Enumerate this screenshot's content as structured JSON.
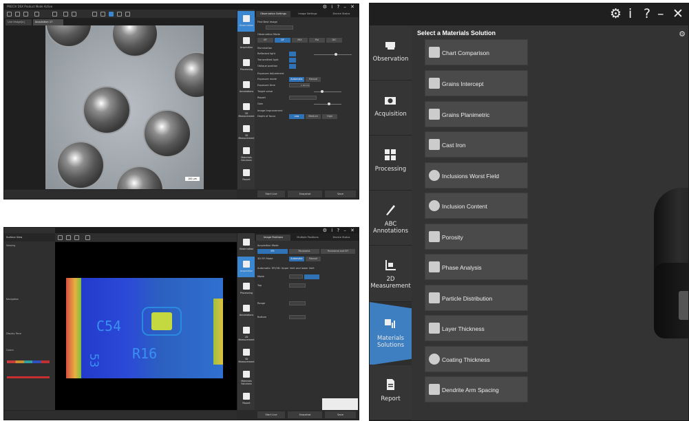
{
  "screen1": {
    "window_title": "PRECiV DSX Product Mode Active",
    "view_tabs": [
      "Live Image[x]",
      "Acquisition 17"
    ],
    "rail_items": [
      "Observation",
      "Acquisition",
      "Processing",
      "Annotations",
      "2D Measurement",
      "3D Measurement",
      "Materials Solutions",
      "Report"
    ],
    "panel_tabs": [
      "Observation Settings",
      "Image Settings",
      "Device Status"
    ],
    "find_best_image": "Find Best Image",
    "observation_mode": "Observation Mode",
    "mode_buttons": [
      "BF",
      "DF",
      "MIX",
      "Pol",
      "DIC"
    ],
    "illumination": "Illumination",
    "reflected_light": "Reflected light",
    "transmitted_light": "Transmitted light",
    "oblique_position": "Oblique position",
    "exposure_adjustment": "Exposure Adjustment",
    "exposure_mode": "Exposure mode",
    "auto": "Automatic",
    "manual": "Manual",
    "exposure_time": "Exposure time",
    "exposure_time_value": "1.00 ms",
    "target_value": "Target value",
    "report": "Report",
    "gain": "Gain",
    "image_improvement": "Image Improvement",
    "depth_of_focus": "Depth of focus",
    "levels": [
      "Low",
      "Medium",
      "High"
    ],
    "scale_bar": "100 µm",
    "actions": [
      "Start Live",
      "Snapshot",
      "Save"
    ]
  },
  "screen2": {
    "rail_items": [
      "Observation",
      "Acquisition",
      "Processing",
      "Annotations",
      "2D Measurement",
      "3D Measurement",
      "Materials Solutions",
      "Report"
    ],
    "panel_tabs": [
      "Image Positions",
      "Multiple Positions",
      "Device Status"
    ],
    "acquisition_mode": "Acquisition Mode",
    "mode_buttons": [
      "EFI",
      "Panorama",
      "Panorama and EFI"
    ],
    "efi_3d": "3D EFI Mode",
    "automatic": "Automatic",
    "manual": "Manual",
    "section_label": "Automatic: EFI/3D: Upper limit and lower limit",
    "fields": [
      "Mode",
      "Top",
      "Range",
      "Bottom"
    ],
    "left_panel_title": "Surface View",
    "left_sections": [
      "Viewing",
      "Navigation",
      "Display Pane",
      "Colors"
    ],
    "board_labels": [
      "C54",
      "R16",
      "53"
    ],
    "actions": [
      "Start Live",
      "Snapshot",
      "Save"
    ]
  },
  "screen3": {
    "controls": [
      "⚙",
      "i",
      "?",
      "–",
      "✕"
    ],
    "title": "Select a Materials Solution",
    "rail": [
      {
        "label": "Observation",
        "icon": "microscope-icon"
      },
      {
        "label": "Acquisition",
        "icon": "camera-icon"
      },
      {
        "label": "Processing",
        "icon": "processing-icon"
      },
      {
        "label": "ABC Annotations",
        "icon": "pen-icon"
      },
      {
        "label": "2D Measurement",
        "icon": "measure-icon"
      },
      {
        "label": "Materials Solutions",
        "icon": "materials-icon"
      },
      {
        "label": "Report",
        "icon": "report-icon"
      }
    ],
    "solutions": [
      "Chart Comparison",
      "Grains Intercept",
      "Grains Planimetric",
      "Cast Iron",
      "Inclusions Worst Field",
      "Inclusion Content",
      "Porosity",
      "Phase Analysis",
      "Particle Distribution",
      "Layer Thickness",
      "Coating Thickness",
      "Dendrite Arm Spacing"
    ],
    "accent": "#3d7fc1"
  }
}
